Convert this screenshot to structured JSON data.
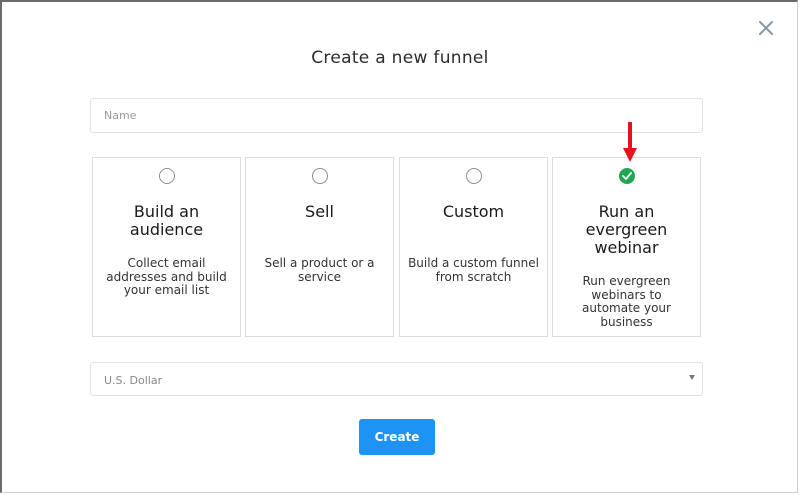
{
  "dialog": {
    "title": "Create a new funnel",
    "close_icon": "close-icon"
  },
  "name_field": {
    "placeholder": "Name",
    "value": ""
  },
  "funnel_types": [
    {
      "title": "Build an audience",
      "description": "Collect email addresses and build your email list",
      "selected": false
    },
    {
      "title": "Sell",
      "description": "Sell a product or a service",
      "selected": false
    },
    {
      "title": "Custom",
      "description": "Build a custom funnel from scratch",
      "selected": false
    },
    {
      "title": "Run an evergreen webinar",
      "description": "Run evergreen webinars to automate your business",
      "selected": true
    }
  ],
  "currency_select": {
    "value": "U.S. Dollar",
    "icon": "caret-down-icon"
  },
  "create_button": {
    "label": "Create"
  },
  "annotation": {
    "icon": "red-arrow-down-icon",
    "color": "#e8101a"
  },
  "colors": {
    "accent": "#1d93f5",
    "selected": "#1fa653",
    "annotation": "#e8101a"
  }
}
